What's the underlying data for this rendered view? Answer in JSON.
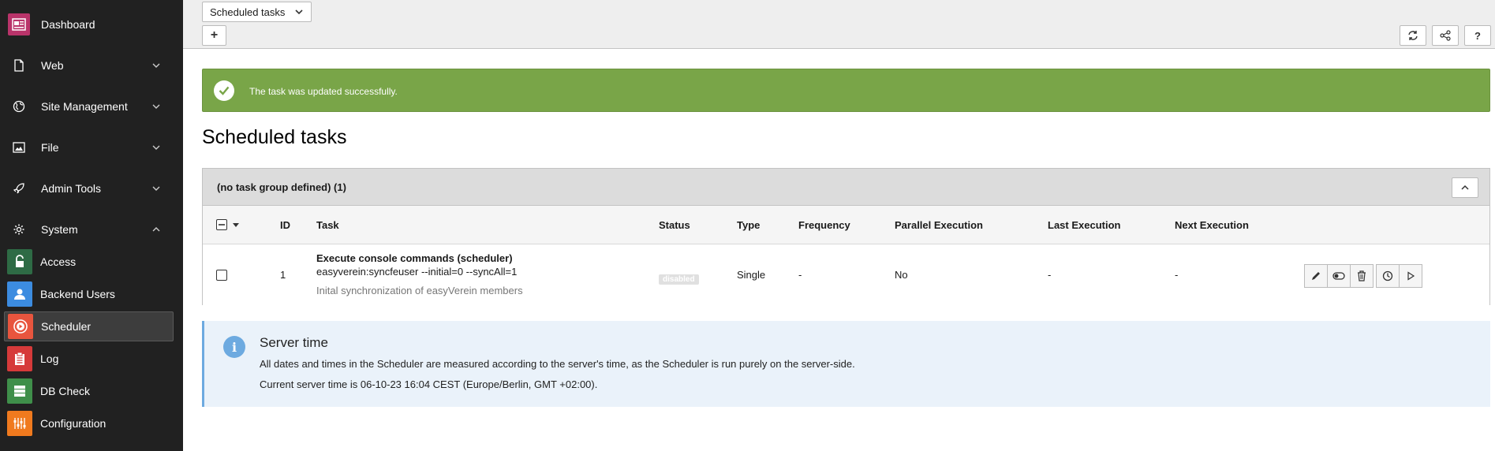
{
  "sidebar": {
    "items": [
      {
        "label": "Dashboard",
        "icon": "dashboard-icon",
        "color": "#b9346a"
      },
      {
        "label": "Web",
        "icon": "page-icon"
      },
      {
        "label": "Site Management",
        "icon": "globe-icon"
      },
      {
        "label": "File",
        "icon": "image-icon"
      },
      {
        "label": "Admin Tools",
        "icon": "rocket-icon"
      },
      {
        "label": "System",
        "icon": "gear-icon"
      }
    ],
    "system_items": [
      {
        "label": "Access",
        "icon": "unlock-icon",
        "color": "#2e6b45"
      },
      {
        "label": "Backend Users",
        "icon": "user-icon",
        "color": "#3c8ce0"
      },
      {
        "label": "Scheduler",
        "icon": "scheduler-icon",
        "color": "#e8553e"
      },
      {
        "label": "Log",
        "icon": "clipboard-icon",
        "color": "#d63a3a"
      },
      {
        "label": "DB Check",
        "icon": "database-icon",
        "color": "#3f8f4a"
      },
      {
        "label": "Configuration",
        "icon": "sliders-icon",
        "color": "#f07a1e"
      }
    ]
  },
  "docheader": {
    "menu_label": "Scheduled tasks",
    "add_label": "+",
    "help_label": "?"
  },
  "alert": {
    "message": "The task was updated successfully.",
    "color": "#79a548"
  },
  "page_title": "Scheduled tasks",
  "panel": {
    "group_title": "(no task group defined) (1)",
    "columns": {
      "id": "ID",
      "task": "Task",
      "status": "Status",
      "type": "Type",
      "frequency": "Frequency",
      "parallel": "Parallel Execution",
      "last": "Last Execution",
      "next": "Next Execution"
    },
    "row": {
      "id": "1",
      "task_name": "Execute console commands (scheduler)",
      "task_command": "easyverein:syncfeuser --initial=0 --syncAll=1",
      "task_description": "Inital synchronization of easyVerein members",
      "status": "disabled",
      "type": "Single",
      "frequency": "-",
      "parallel": "No",
      "last": "-",
      "next": "-"
    }
  },
  "callout": {
    "title": "Server time",
    "line1": "All dates and times in the Scheduler are measured according to the server's time, as the Scheduler is run purely on the server-side.",
    "line2": "Current server time is 06-10-23 16:04 CEST (Europe/Berlin, GMT +02:00).",
    "color": "#6daae0"
  }
}
